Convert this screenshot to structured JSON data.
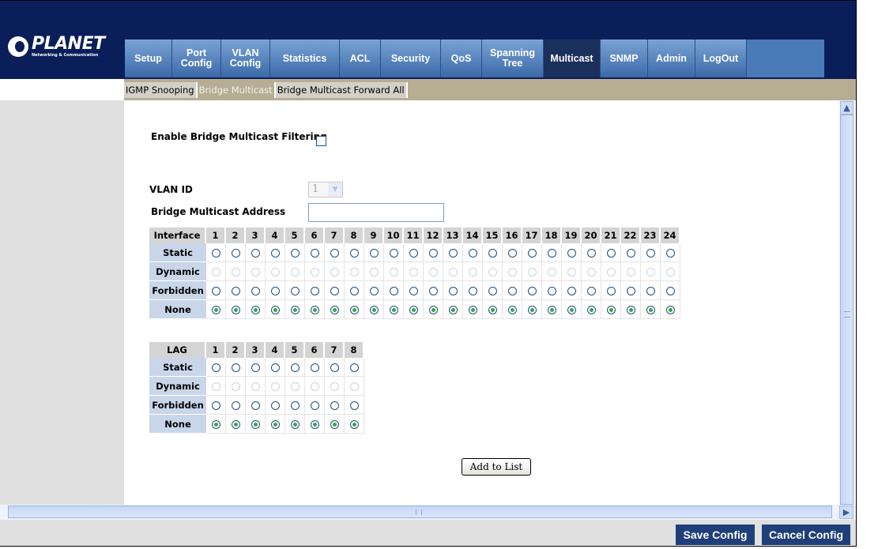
{
  "brand": {
    "name": "PLANET",
    "tagline": "Networking & Communication"
  },
  "nav": [
    {
      "label": "Setup",
      "active": false
    },
    {
      "label": "Port\nConfig",
      "active": false
    },
    {
      "label": "VLAN\nConfig",
      "active": false
    },
    {
      "label": "Statistics",
      "active": false
    },
    {
      "label": "ACL",
      "active": false
    },
    {
      "label": "Security",
      "active": false
    },
    {
      "label": "QoS",
      "active": false
    },
    {
      "label": "Spanning\nTree",
      "active": false
    },
    {
      "label": "Multicast",
      "active": true
    },
    {
      "label": "SNMP",
      "active": false
    },
    {
      "label": "Admin",
      "active": false
    },
    {
      "label": "LogOut",
      "active": false
    }
  ],
  "subnav": [
    {
      "label": "IGMP Snooping",
      "active": false
    },
    {
      "label": "Bridge Multicast",
      "active": true
    },
    {
      "label": "Bridge Multicast Forward All",
      "active": false
    }
  ],
  "form": {
    "enable_label": "Enable Bridge Multicast Filtering",
    "enable_checked": false,
    "vlan_label": "VLAN ID",
    "vlan_value": "1",
    "address_label": "Bridge Multicast Address",
    "address_value": ""
  },
  "interface_table": {
    "header": "Interface",
    "ports": [
      "1",
      "2",
      "3",
      "4",
      "5",
      "6",
      "7",
      "8",
      "9",
      "10",
      "11",
      "12",
      "13",
      "14",
      "15",
      "16",
      "17",
      "18",
      "19",
      "20",
      "21",
      "22",
      "23",
      "24"
    ],
    "rows": [
      {
        "label": "Static",
        "disabled": false,
        "checked": false
      },
      {
        "label": "Dynamic",
        "disabled": true,
        "checked": false
      },
      {
        "label": "Forbidden",
        "disabled": false,
        "checked": false
      },
      {
        "label": "None",
        "disabled": false,
        "checked": true
      }
    ]
  },
  "lag_table": {
    "header": "LAG",
    "ports": [
      "1",
      "2",
      "3",
      "4",
      "5",
      "6",
      "7",
      "8"
    ],
    "rows": [
      {
        "label": "Static",
        "disabled": false,
        "checked": false
      },
      {
        "label": "Dynamic",
        "disabled": true,
        "checked": false
      },
      {
        "label": "Forbidden",
        "disabled": false,
        "checked": false
      },
      {
        "label": "None",
        "disabled": false,
        "checked": true
      }
    ]
  },
  "buttons": {
    "add": "Add to List",
    "save": "Save Config",
    "cancel": "Cancel Config"
  },
  "colors": {
    "header_bg": "#0a1e5a",
    "nav_active": "#1a2f5c",
    "radio_selected": "#3ca246",
    "footer_button": "#1e3f7a"
  }
}
